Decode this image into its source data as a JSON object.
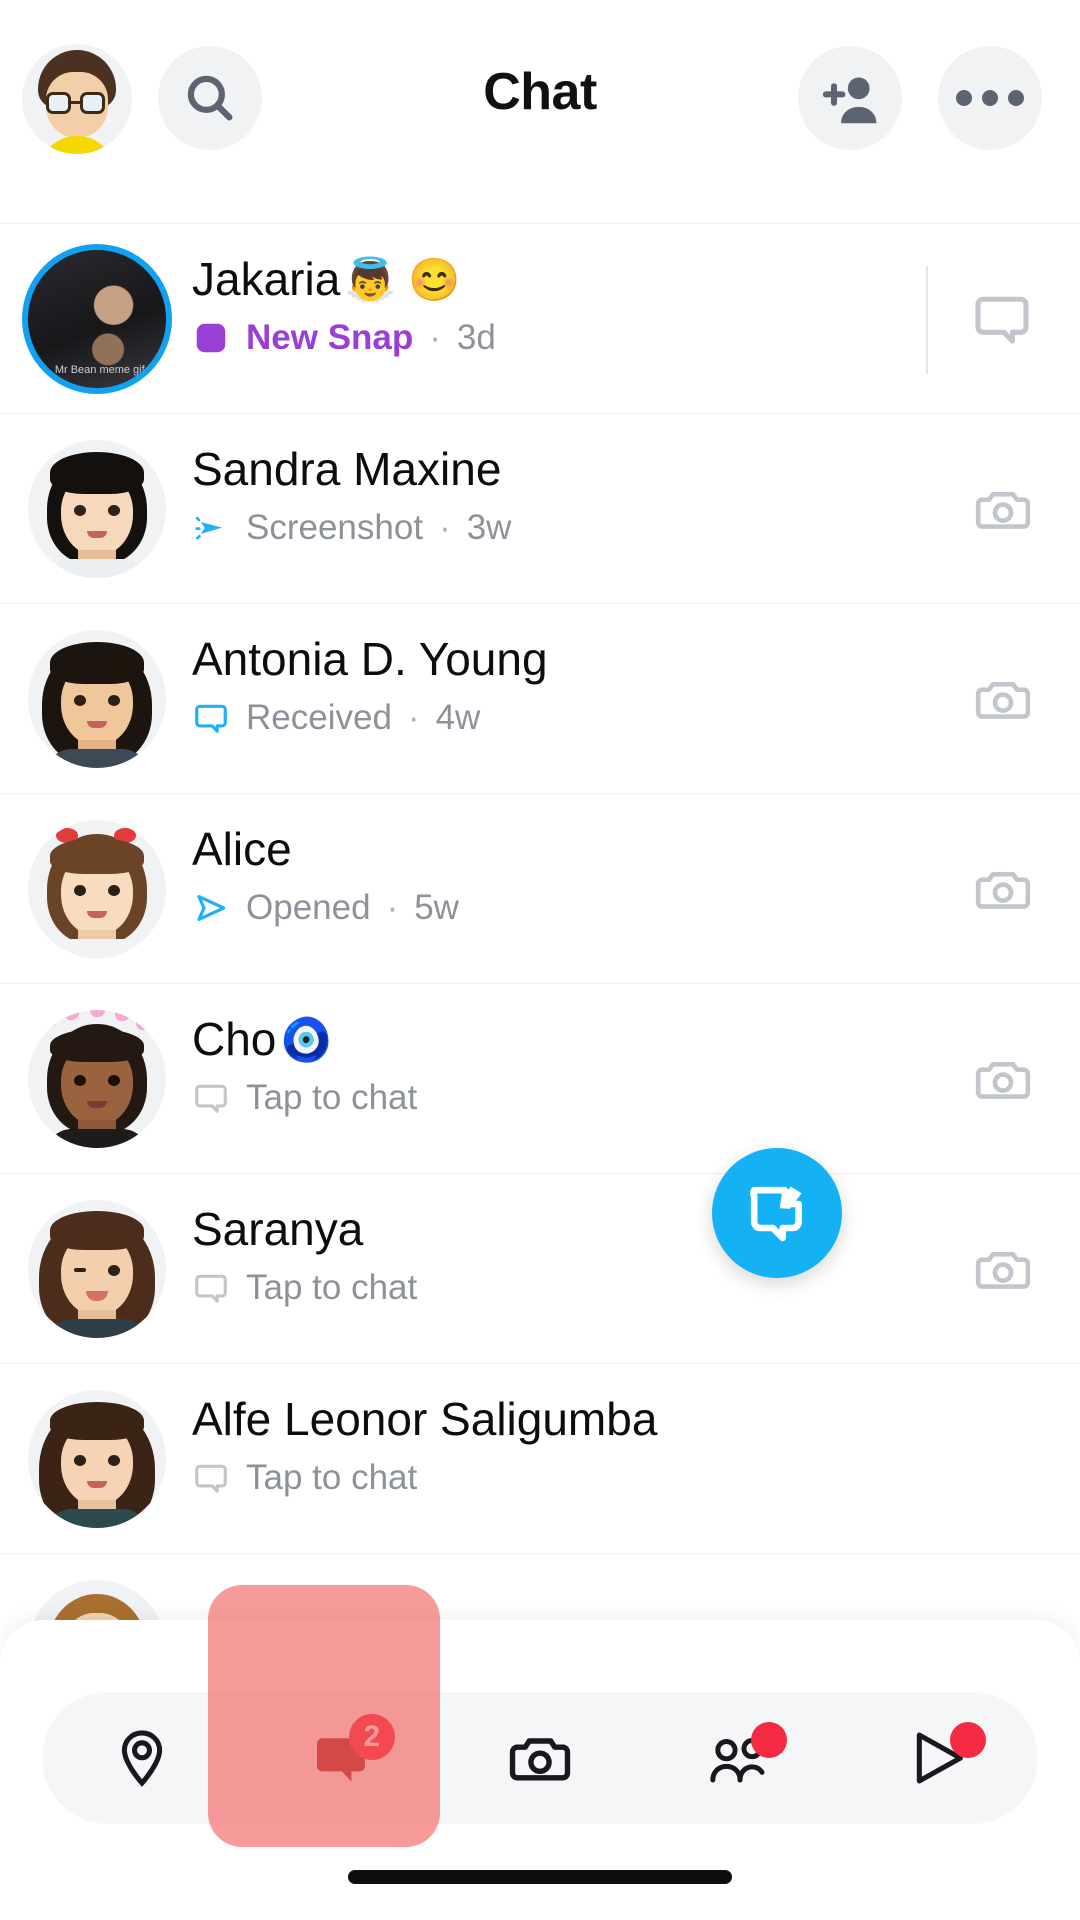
{
  "header": {
    "title": "Chat",
    "profile_icon": "bitmoji-avatar",
    "search_icon": "search-icon",
    "add_friend_icon": "add-friend-icon",
    "more_icon": "more-options-icon"
  },
  "chats": [
    {
      "name": "Jakaria",
      "name_emoji": "👼 😊",
      "status": "New Snap",
      "status_type": "new-snap",
      "status_icon": "snap-square-filled-icon",
      "time": "3d",
      "separator": "·",
      "unread": true,
      "story_ring": true,
      "avatar_type": "photo",
      "avatar_caption": "Mr Bean meme gif",
      "action_icon": "chat-bubble-icon",
      "has_divider": true
    },
    {
      "name": "Sandra Maxine",
      "name_emoji": "",
      "status": "Screenshot",
      "status_type": "screenshot",
      "status_icon": "screenshot-arrow-icon",
      "time": "3w",
      "separator": "·",
      "unread": false,
      "story_ring": false,
      "avatar_type": "bitmoji-bob-black",
      "action_icon": "camera-icon",
      "has_divider": false
    },
    {
      "name": "Antonia D. Young",
      "name_emoji": "",
      "status": "Received",
      "status_type": "received",
      "status_icon": "chat-bubble-blue-icon",
      "time": "4w",
      "separator": "·",
      "unread": false,
      "story_ring": false,
      "avatar_type": "bitmoji-long-black",
      "action_icon": "camera-icon",
      "has_divider": false
    },
    {
      "name": "Alice",
      "name_emoji": "",
      "status": "Opened",
      "status_type": "opened",
      "status_icon": "snap-arrow-blue-icon",
      "time": "5w",
      "separator": "·",
      "unread": false,
      "story_ring": false,
      "avatar_type": "bitmoji-bow-brown",
      "action_icon": "camera-icon",
      "has_divider": false
    },
    {
      "name": "Cho",
      "name_emoji": "🧿",
      "status": "Tap to chat",
      "status_type": "tap-to-chat",
      "status_icon": "chat-bubble-gray-icon",
      "time": "",
      "separator": "",
      "unread": false,
      "story_ring": false,
      "avatar_type": "bitmoji-hearts-crown",
      "action_icon": "camera-icon",
      "has_divider": false
    },
    {
      "name": "Saranya",
      "name_emoji": "",
      "status": "Tap to chat",
      "status_type": "tap-to-chat",
      "status_icon": "chat-bubble-gray-icon",
      "time": "",
      "separator": "",
      "unread": false,
      "story_ring": false,
      "avatar_type": "bitmoji-wink-tongue",
      "action_icon": "camera-icon",
      "has_divider": false
    },
    {
      "name": "Alfe Leonor Saligumba",
      "name_emoji": "",
      "status": "Tap to chat",
      "status_type": "tap-to-chat",
      "status_icon": "chat-bubble-gray-icon",
      "time": "",
      "separator": "",
      "unread": false,
      "story_ring": false,
      "avatar_type": "bitmoji-long-brown",
      "action_icon": "",
      "has_divider": false
    }
  ],
  "fab": {
    "icon": "new-chat-compose-icon"
  },
  "bottom_nav": {
    "items": [
      {
        "name": "map",
        "icon": "map-pin-icon",
        "badge": "",
        "badge_type": "none",
        "active": false
      },
      {
        "name": "chat",
        "icon": "chat-bubble-filled-icon",
        "badge": "2",
        "badge_type": "count",
        "active": true
      },
      {
        "name": "camera",
        "icon": "camera-icon",
        "badge": "",
        "badge_type": "none",
        "active": false
      },
      {
        "name": "friends",
        "icon": "friends-icon",
        "badge": "",
        "badge_type": "dot",
        "active": false
      },
      {
        "name": "spotlight",
        "icon": "spotlight-play-icon",
        "badge": "",
        "badge_type": "dot",
        "active": false
      }
    ]
  },
  "colors": {
    "accent_blue": "#14b1f5",
    "snap_purple": "#9a3fd6",
    "badge_red": "#f42b42",
    "highlight_red": "rgba(242,92,92,0.62)",
    "muted_text": "#8d929a"
  }
}
